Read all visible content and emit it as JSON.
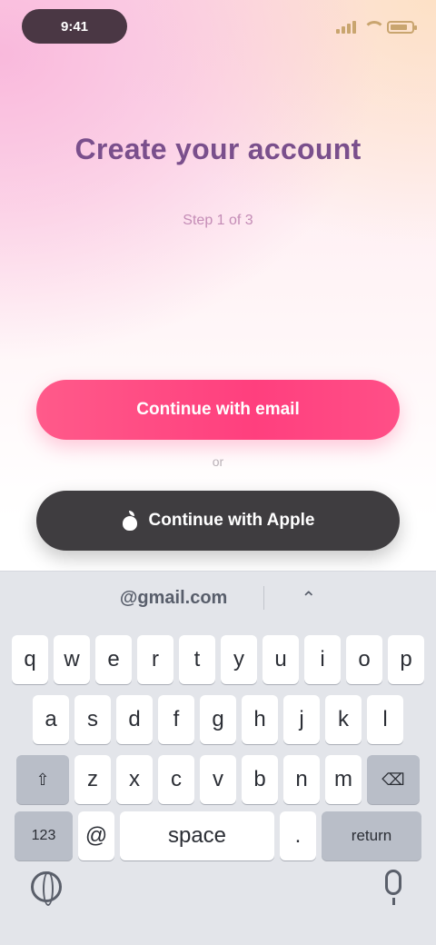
{
  "status_bar": {
    "time": "9:41"
  },
  "header": {
    "title": "Create your account",
    "subtitle": "Step 1 of 3"
  },
  "actions": {
    "primary_label": "Continue with email",
    "divider": "or",
    "apple_label": "Continue with Apple"
  },
  "keyboard": {
    "suggestions": [
      "@gmail.com"
    ],
    "rows": [
      [
        "q",
        "w",
        "e",
        "r",
        "t",
        "y",
        "u",
        "i",
        "o",
        "p"
      ],
      [
        "a",
        "s",
        "d",
        "f",
        "g",
        "h",
        "j",
        "k",
        "l"
      ],
      [
        "⇧",
        "z",
        "x",
        "c",
        "v",
        "b",
        "n",
        "m",
        "⌫"
      ]
    ],
    "bottom_row": {
      "numbers": "123",
      "at": "@",
      "space": "space",
      "dot": ".",
      "return": "return"
    }
  }
}
